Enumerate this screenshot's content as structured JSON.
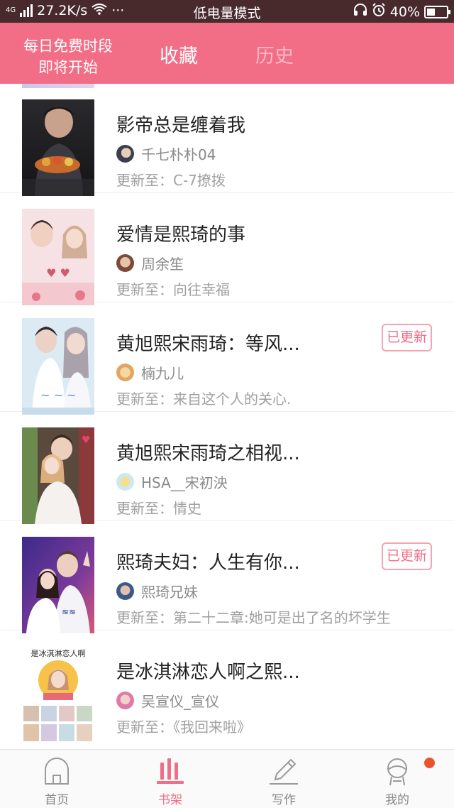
{
  "status_bar": {
    "network": "4G",
    "speed": "27.2K/s",
    "more": "···",
    "mode": "低电量模式",
    "battery": "40%",
    "battery_level": 0.4
  },
  "header": {
    "promo_line1": "每日免费时段",
    "promo_line2": "即将开始",
    "tab_favorites": "收藏",
    "tab_history": "历史",
    "accent_color": "#f26d86"
  },
  "books": [
    {
      "title": "影帝总是缠着我",
      "author": "千七朴朴04",
      "update_prefix": "更新至：",
      "update": "C-7撩拨",
      "badge": ""
    },
    {
      "title": "爱情是熙琦的事",
      "author": "周余笙",
      "update_prefix": "更新至：",
      "update": "向往幸福",
      "badge": ""
    },
    {
      "title": "黄旭熙宋雨琦：等风...",
      "author": "楠九儿",
      "update_prefix": "更新至：",
      "update": "来自这个人的关心.",
      "badge": "已更新"
    },
    {
      "title": "黄旭熙宋雨琦之相视...",
      "author": "HSA__宋初泱",
      "update_prefix": "更新至：",
      "update": "情史",
      "badge": ""
    },
    {
      "title": "熙琦夫妇：人生有你...",
      "author": "熙琦兄妹",
      "update_prefix": "更新至：",
      "update": "第二十二章:她可是出了名的坏学生",
      "badge": "已更新"
    },
    {
      "title": "是冰淇淋恋人啊之熙...",
      "author": "吴宣仪_宣仪",
      "update_prefix": "更新至：",
      "update": "《我回来啦》",
      "badge": ""
    }
  ],
  "covers": {
    "cover6_text": "是冰淇淋恋人啊"
  },
  "bottom_nav": {
    "home": "首页",
    "shelf": "书架",
    "write": "写作",
    "mine": "我的"
  }
}
